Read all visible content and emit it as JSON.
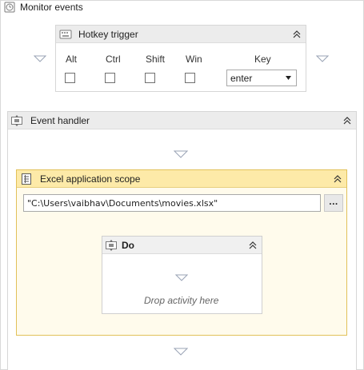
{
  "monitor": {
    "title": "Monitor events",
    "icon": "clock-icon"
  },
  "hotkey": {
    "title": "Hotkey trigger",
    "icon": "keyboard-icon",
    "modifiers": [
      {
        "label": "Alt",
        "checked": false
      },
      {
        "label": "Ctrl",
        "checked": false
      },
      {
        "label": "Shift",
        "checked": false
      },
      {
        "label": "Win",
        "checked": false
      }
    ],
    "key_label": "Key",
    "key_value": "enter"
  },
  "event_handler": {
    "title": "Event handler",
    "icon": "sequence-icon"
  },
  "excel_scope": {
    "title": "Excel application scope",
    "icon": "excel-icon",
    "path_value": "\"C:\\Users\\vaibhav\\Documents\\movies.xlsx\"",
    "browse_label": "..."
  },
  "do_block": {
    "title": "Do",
    "icon": "sequence-icon",
    "placeholder": "Drop activity here"
  },
  "colors": {
    "scope_header": "#fdeaa8",
    "scope_border": "#e2c159",
    "scope_bg": "#fffbec"
  }
}
